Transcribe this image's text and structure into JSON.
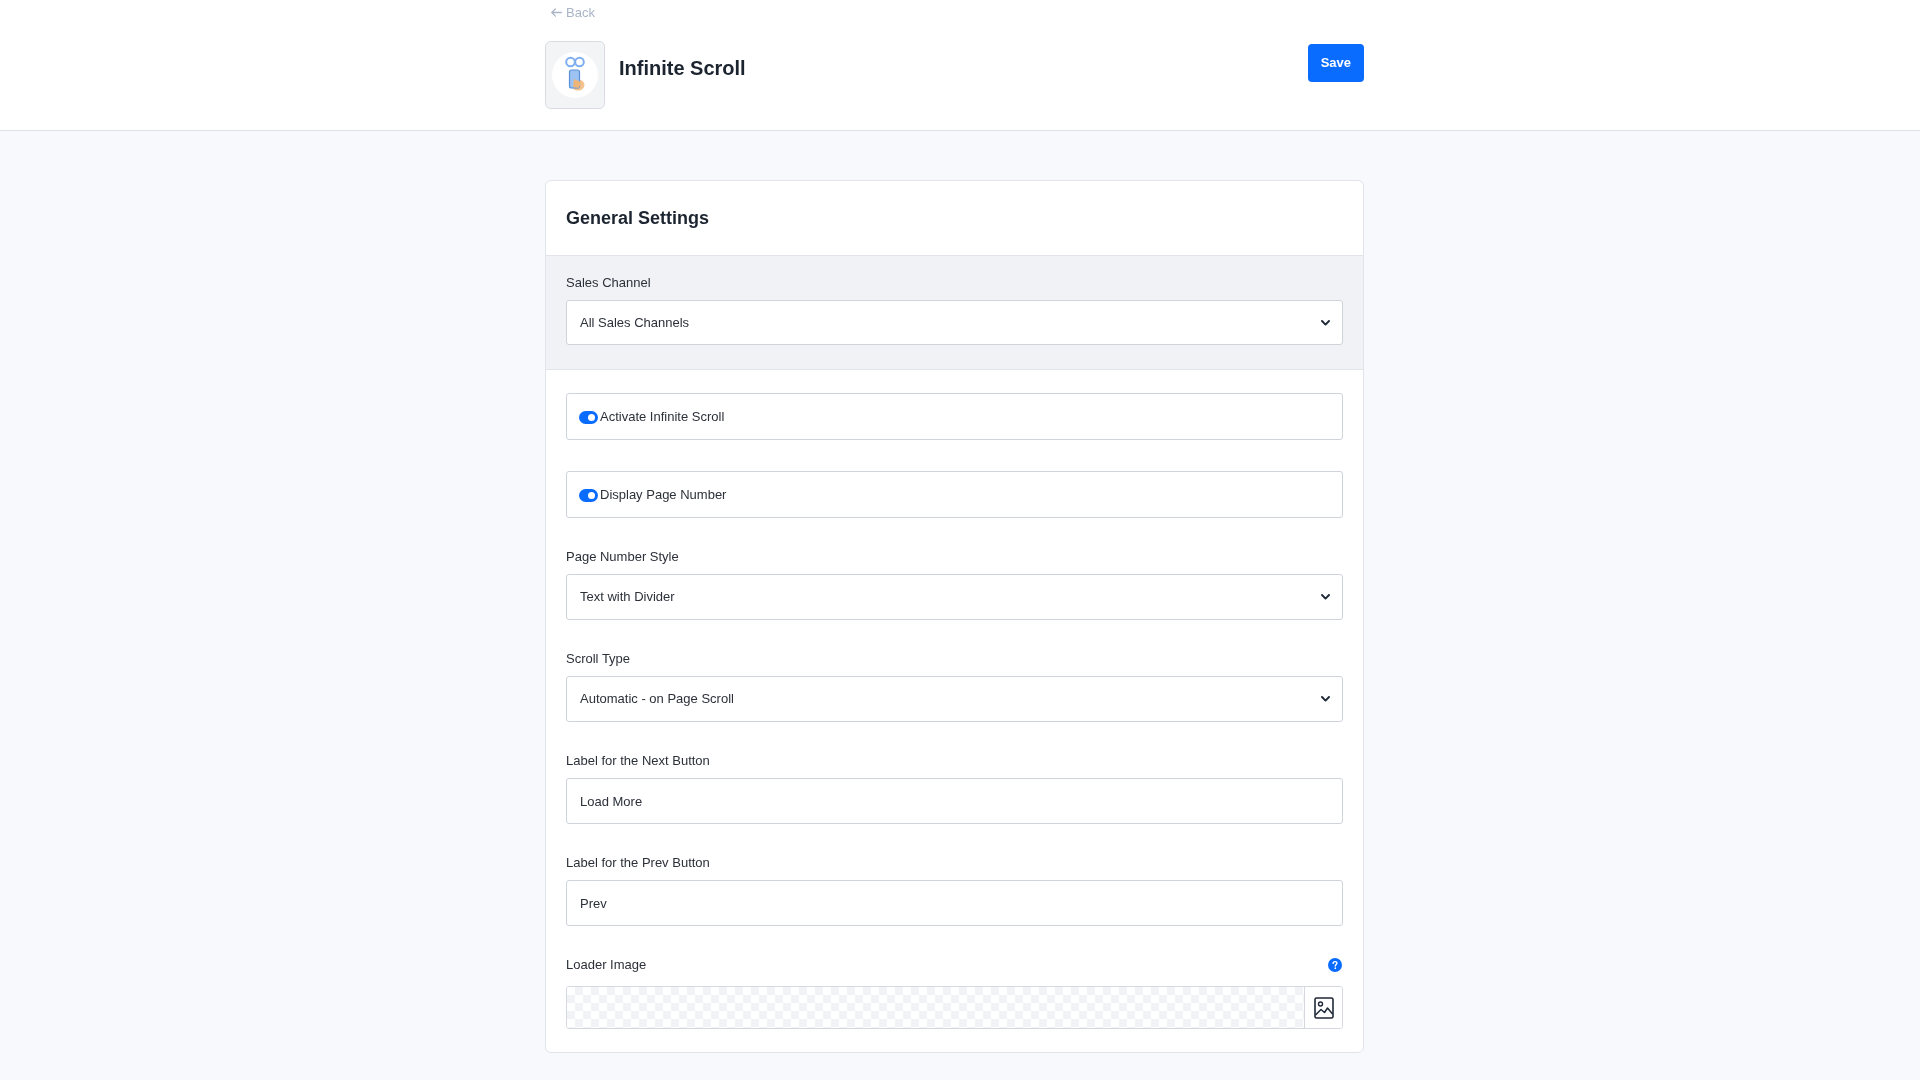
{
  "back_link": {
    "label": "Back"
  },
  "header": {
    "title": "Infinite Scroll",
    "save_button": "Save"
  },
  "general_settings": {
    "title": "General Settings",
    "sales_channel": {
      "label": "Sales Channel",
      "value": "All Sales Channels"
    },
    "fields": [
      {
        "kind": "toggle",
        "label": "Activate Infinite Scroll",
        "on": true
      },
      {
        "kind": "toggle",
        "label": "Display Page Number",
        "on": true
      },
      {
        "kind": "select",
        "label": "Page Number Style",
        "value": "Text with Divider"
      },
      {
        "kind": "select",
        "label": "Scroll Type",
        "value": "Automatic - on Page Scroll"
      },
      {
        "kind": "text",
        "label": "Label for the Next Button",
        "value": "Load More"
      },
      {
        "kind": "text",
        "label": "Label for the Prev Button",
        "value": "Prev"
      },
      {
        "kind": "image",
        "label": "Loader Image"
      }
    ]
  }
}
